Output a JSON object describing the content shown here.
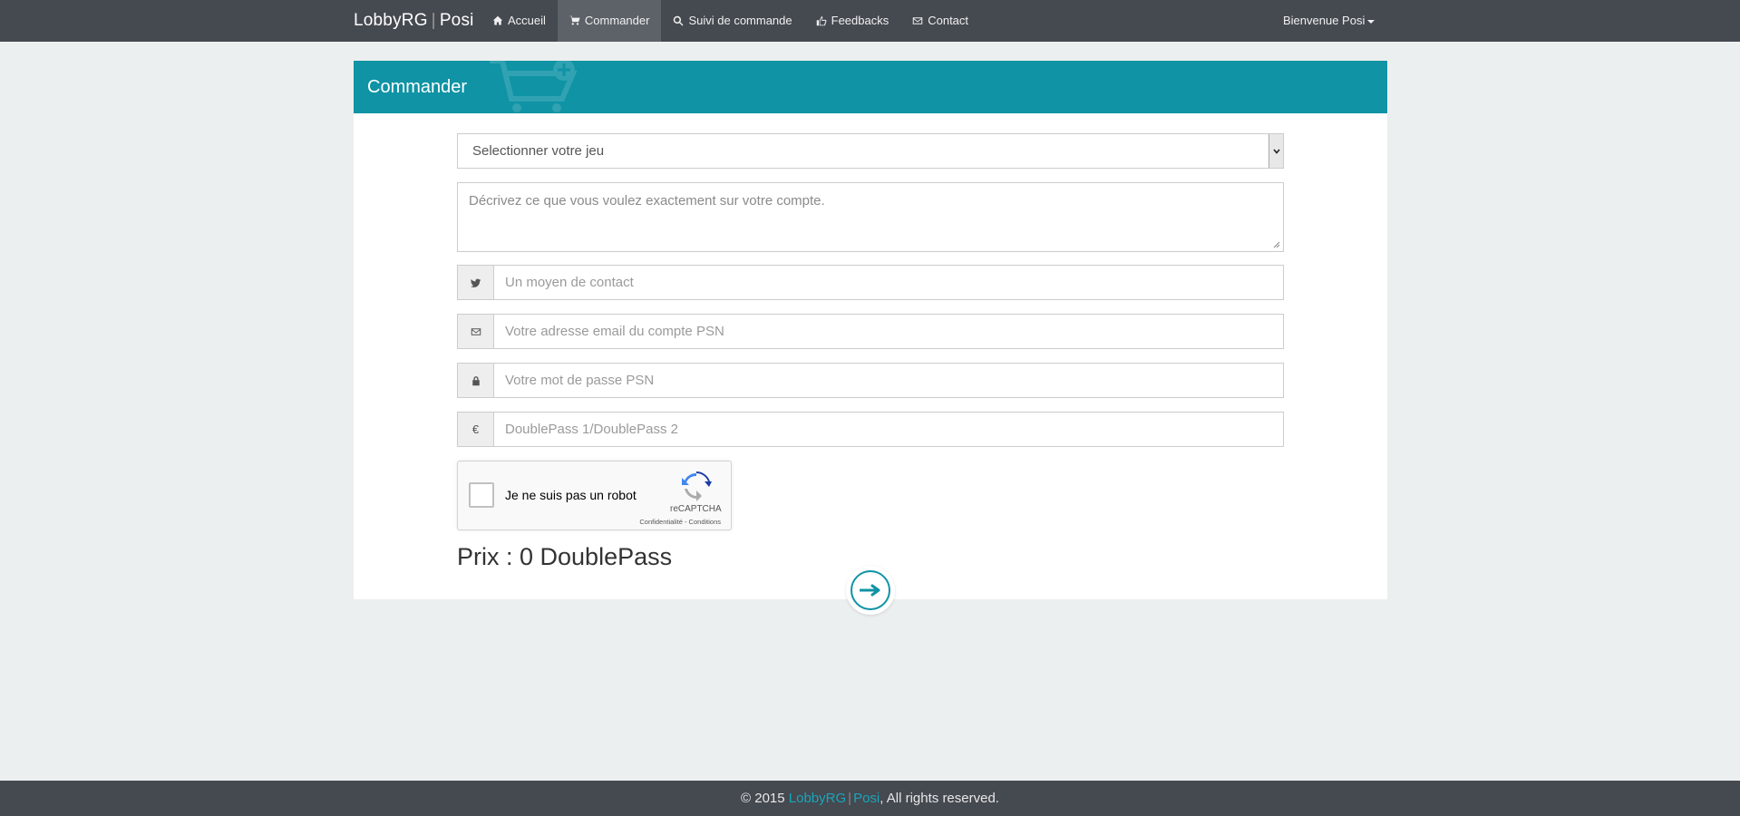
{
  "navbar": {
    "brand_left": "LobbyRG",
    "brand_sep": "|",
    "brand_right": "Posi",
    "items": [
      {
        "label": "Accueil",
        "icon": "home-icon",
        "active": false
      },
      {
        "label": "Commander",
        "icon": "shopping-cart-icon",
        "active": true
      },
      {
        "label": "Suivi de commande",
        "icon": "search-icon",
        "active": false
      },
      {
        "label": "Feedbacks",
        "icon": "thumbs-up-icon",
        "active": false
      },
      {
        "label": "Contact",
        "icon": "envelope-icon",
        "active": false
      }
    ],
    "user_menu": "Bienvenue Posi"
  },
  "panel": {
    "title": "Commander",
    "accent_color": "#0f93a5"
  },
  "form": {
    "game_select": {
      "selected": "Selectionner votre jeu"
    },
    "description": {
      "placeholder": "Décrivez ce que vous voulez exactement sur votre compte."
    },
    "contact": {
      "icon": "twitter-icon",
      "placeholder": "Un moyen de contact"
    },
    "email": {
      "icon": "envelope-icon",
      "placeholder": "Votre adresse email du compte PSN"
    },
    "password": {
      "icon": "lock-icon",
      "placeholder": "Votre mot de passe PSN"
    },
    "payment": {
      "icon": "euro-icon",
      "addon_symbol": "€",
      "placeholder": "DoublePass 1/DoublePass 2"
    }
  },
  "captcha": {
    "label": "Je ne suis pas un robot",
    "brand": "reCAPTCHA",
    "links": "Confidentialité - Conditions"
  },
  "price": {
    "text": "Prix : 0 DoublePass"
  },
  "footer": {
    "copyright": "© 2015 ",
    "link_left": "LobbyRG",
    "link_sep": "|",
    "link_right": "Posi",
    "suffix": ", All rights reserved."
  }
}
